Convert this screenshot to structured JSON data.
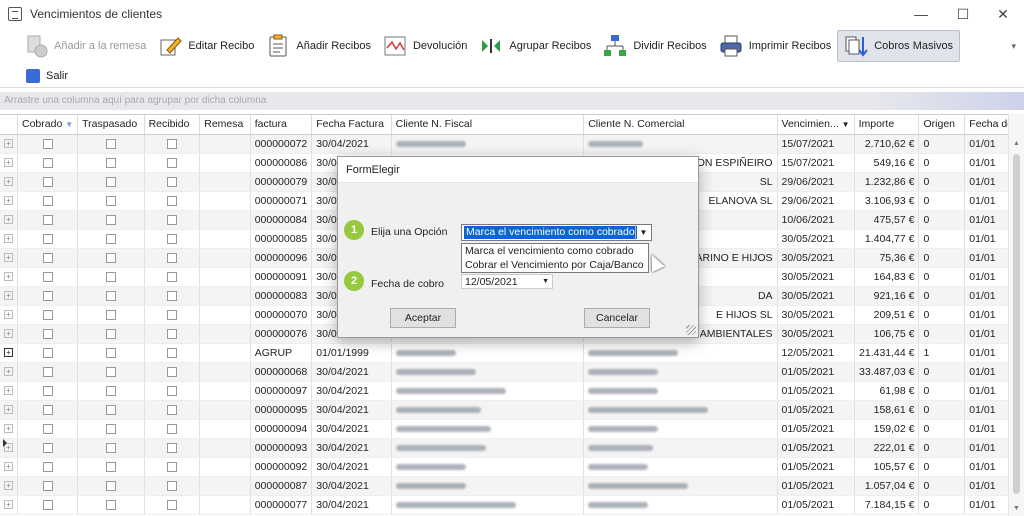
{
  "window": {
    "title": "Vencimientos de clientes",
    "minimize": "—",
    "maximize": "☐",
    "close": "✕"
  },
  "toolbar": {
    "items": [
      {
        "label": "Añadir a la remesa",
        "icon": "add-to-batch-icon"
      },
      {
        "label": "Editar Recibo",
        "icon": "pencil-icon"
      },
      {
        "label": "Añadir Recibos",
        "icon": "clipboard-icon"
      },
      {
        "label": "Devolución",
        "icon": "chart-return-icon"
      },
      {
        "label": "Agrupar Recibos",
        "icon": "merge-icon"
      },
      {
        "label": "Dividir Recibos",
        "icon": "split-tree-icon"
      },
      {
        "label": "Imprimir Recibos",
        "icon": "printer-icon"
      },
      {
        "label": "Cobros Masivos",
        "icon": "bulk-collect-icon"
      }
    ],
    "salir": "Salir",
    "overflow": "▾"
  },
  "groupbar": "Arrastre una columna aquí para agrupar por dicha columna",
  "columns": [
    "Cobrado",
    "Traspasado",
    "Recibido",
    "Remesa",
    "factura",
    "Fecha Factura",
    "Cliente N. Fiscal",
    "Cliente N. Comercial",
    "Vencimien...",
    "Importe",
    "Origen",
    "Fecha de"
  ],
  "rows": [
    {
      "factura": "000000072",
      "fecha": "30/04/2021",
      "comercial": "",
      "venc": "15/07/2021",
      "importe": "2.710,62 €",
      "origen": "0",
      "fechade": "01/01"
    },
    {
      "factura": "000000086",
      "fecha": "30/04/2021",
      "comercial": "UCCION ESPIÑEIRO",
      "venc": "15/07/2021",
      "importe": "549,16 €",
      "origen": "0",
      "fechade": "01/01"
    },
    {
      "factura": "000000079",
      "fecha": "30/04/2021",
      "comercial": "SL",
      "venc": "29/06/2021",
      "importe": "1.232,86 €",
      "origen": "0",
      "fechade": "01/01"
    },
    {
      "factura": "000000071",
      "fecha": "30/04/2021",
      "comercial": "ELANOVA SL",
      "venc": "29/06/2021",
      "importe": "3.106,93 €",
      "origen": "0",
      "fechade": "01/01"
    },
    {
      "factura": "000000084",
      "fecha": "30/04/2021",
      "comercial": "",
      "venc": "10/06/2021",
      "importe": "475,57 €",
      "origen": "0",
      "fechade": "01/01"
    },
    {
      "factura": "000000085",
      "fecha": "30/04/2021",
      "comercial": "",
      "venc": "30/05/2021",
      "importe": "1.404,77 €",
      "origen": "0",
      "fechade": "01/01"
    },
    {
      "factura": "000000096",
      "fecha": "30/04/2021",
      "comercial": "ILLARINO E HIJOS",
      "venc": "30/05/2021",
      "importe": "75,36 €",
      "origen": "0",
      "fechade": "01/01"
    },
    {
      "factura": "000000091",
      "fecha": "30/04/2021",
      "comercial": "",
      "venc": "30/05/2021",
      "importe": "164,83 €",
      "origen": "0",
      "fechade": "01/01"
    },
    {
      "factura": "000000083",
      "fecha": "30/04/2021",
      "comercial": "DA",
      "venc": "30/05/2021",
      "importe": "921,16 €",
      "origen": "0",
      "fechade": "01/01"
    },
    {
      "factura": "000000070",
      "fecha": "30/04/2021",
      "comercial": "E HIJOS SL",
      "venc": "30/05/2021",
      "importe": "209,51 €",
      "origen": "0",
      "fechade": "01/01"
    },
    {
      "factura": "000000076",
      "fecha": "30/04/2021",
      "comercial": "AMBIENTALES",
      "venc": "30/05/2021",
      "importe": "106,75 €",
      "origen": "0",
      "fechade": "01/01"
    },
    {
      "factura": "AGRUP",
      "fecha": "01/01/1999",
      "comercial": "",
      "venc": "12/05/2021",
      "importe": "21.431,44 €",
      "origen": "1",
      "fechade": "01/01"
    },
    {
      "factura": "000000068",
      "fecha": "30/04/2021",
      "comercial": "",
      "venc": "01/05/2021",
      "importe": "33.487,03 €",
      "origen": "0",
      "fechade": "01/01"
    },
    {
      "factura": "000000097",
      "fecha": "30/04/2021",
      "comercial": "",
      "venc": "01/05/2021",
      "importe": "61,98 €",
      "origen": "0",
      "fechade": "01/01"
    },
    {
      "factura": "000000095",
      "fecha": "30/04/2021",
      "comercial": "",
      "venc": "01/05/2021",
      "importe": "158,61 €",
      "origen": "0",
      "fechade": "01/01"
    },
    {
      "factura": "000000094",
      "fecha": "30/04/2021",
      "comercial": "",
      "venc": "01/05/2021",
      "importe": "159,02 €",
      "origen": "0",
      "fechade": "01/01"
    },
    {
      "factura": "000000093",
      "fecha": "30/04/2021",
      "comercial": "",
      "venc": "01/05/2021",
      "importe": "222,01 €",
      "origen": "0",
      "fechade": "01/01"
    },
    {
      "factura": "000000092",
      "fecha": "30/04/2021",
      "comercial": "",
      "venc": "01/05/2021",
      "importe": "105,57 €",
      "origen": "0",
      "fechade": "01/01"
    },
    {
      "factura": "000000087",
      "fecha": "30/04/2021",
      "comercial": "",
      "venc": "01/05/2021",
      "importe": "1.057,04 €",
      "origen": "0",
      "fechade": "01/01"
    },
    {
      "factura": "000000077",
      "fecha": "30/04/2021",
      "comercial": "",
      "venc": "01/05/2021",
      "importe": "7.184,15 €",
      "origen": "0",
      "fechade": "01/01"
    }
  ],
  "dialog": {
    "title": "FormElegir",
    "step1": "1",
    "step2": "2",
    "opcion_label": "Elija una Opción",
    "opcion_value": "Marca el vencimiento como cobrado",
    "options": [
      "Marca el vencimiento como cobrado",
      "Cobrar el Vencimiento por Caja/Banco"
    ],
    "fecha_label": "Fecha de cobro",
    "fecha_value": "12/05/2021",
    "aceptar": "Aceptar",
    "cancelar": "Cancelar"
  },
  "colors": {
    "badge": "#96c93d",
    "selection": "#0a64d8"
  }
}
